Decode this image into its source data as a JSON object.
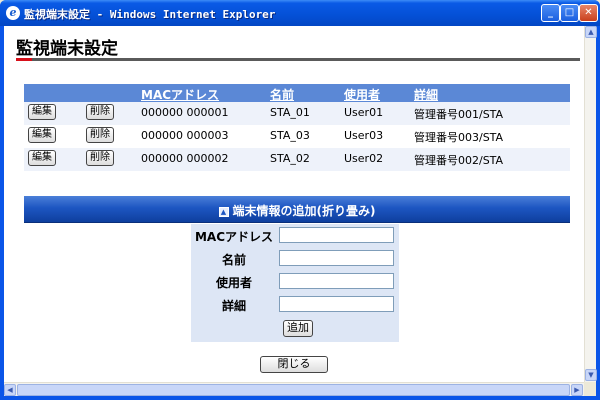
{
  "window": {
    "title": "監視端末設定 - Windows Internet Explorer",
    "icon": "ie-icon",
    "controls": [
      "minimize",
      "maximize",
      "close"
    ]
  },
  "page": {
    "title": "監視端末設定"
  },
  "table": {
    "headers": {
      "mac": "MACアドレス",
      "name": "名前",
      "user": "使用者",
      "detail": "詳細"
    },
    "rows": [
      {
        "edit": "編集",
        "delete": "削除",
        "mac": "000000 000001",
        "name": "STA_01",
        "user": "User01",
        "detail": "管理番号001/STA"
      },
      {
        "edit": "編集",
        "delete": "削除",
        "mac": "000000 000003",
        "name": "STA_03",
        "user": "User03",
        "detail": "管理番号003/STA"
      },
      {
        "edit": "編集",
        "delete": "削除",
        "mac": "000000 000002",
        "name": "STA_02",
        "user": "User02",
        "detail": "管理番号002/STA"
      }
    ]
  },
  "add_section": {
    "title": "端末情報の追加(折り畳み)",
    "fields": {
      "mac": {
        "label": "MACアドレス",
        "value": ""
      },
      "name": {
        "label": "名前",
        "value": ""
      },
      "user": {
        "label": "使用者",
        "value": ""
      },
      "detail": {
        "label": "詳細",
        "value": ""
      }
    },
    "add_button": "追加"
  },
  "close_button": "閉じる",
  "colors": {
    "accent": "#d7101a",
    "table_header": "#5b88d6",
    "section_bar": "#1d56c2",
    "form_bg": "#dde6f5"
  }
}
